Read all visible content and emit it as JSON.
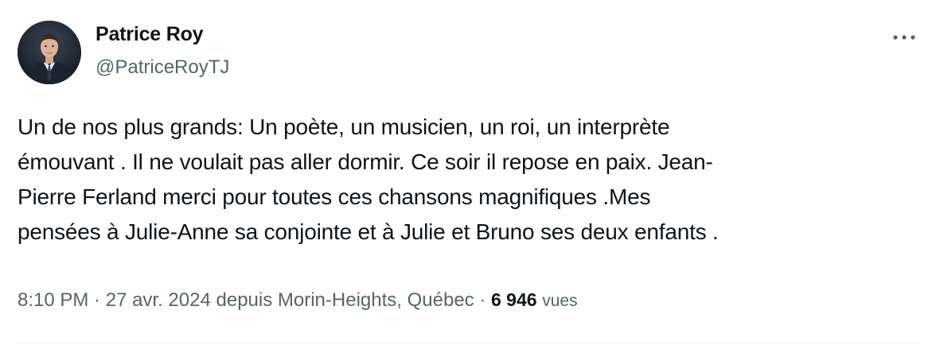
{
  "author": {
    "display_name": "Patrice Roy",
    "handle": "@PatriceRoyTJ"
  },
  "tweet": {
    "lines": [
      "Un de nos plus grands: Un poète, un musicien, un roi, un interprète",
      "émouvant . Il ne voulait pas aller dormir. Ce soir il repose en paix. Jean-",
      "Pierre Ferland merci pour toutes ces chansons magnifiques .Mes",
      "pensées à Julie-Anne sa conjointe et à Julie et Bruno ses deux enfants ."
    ]
  },
  "meta": {
    "time": "8:10 PM",
    "separator": " · ",
    "date": "27 avr. 2024",
    "location_text": " depuis Morin-Heights, Québec",
    "views_count": "6 946",
    "views_label": "vues"
  },
  "icons": {
    "more": "more-horizontal-icon"
  },
  "colors": {
    "text_primary": "#0f1419",
    "text_secondary": "#536471",
    "divider": "#eff3f4"
  }
}
